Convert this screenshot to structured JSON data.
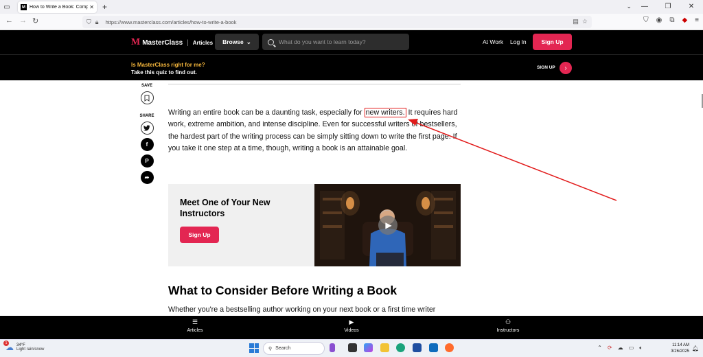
{
  "browser": {
    "tab_title": "How to Write a Book: Complete",
    "tab_favicon": "M",
    "url": "https://www.masterclass.com/articles/how-to-write-a-book"
  },
  "header": {
    "logo_text": "MasterClass",
    "logo_mark": "M",
    "section": "Articles",
    "browse_label": "Browse",
    "search_placeholder": "What do you want to learn today?",
    "at_work": "At Work",
    "log_in": "Log In",
    "sign_up": "Sign Up"
  },
  "quiz": {
    "question": "Is MasterClass right for me?",
    "subtitle": "Take this quiz to find out.",
    "sign_up": "SIGN UP"
  },
  "sidebar": {
    "save_label": "SAVE",
    "share_label": "SHARE"
  },
  "article": {
    "para_before": "Writing an entire book can be a daunting task, especially for ",
    "link_text": "new writers.",
    "para_after": " It requires hard work, extreme ambition, and intense discipline. Even for successful writers of bestsellers, the hardest part of the writing process can be simply sitting down to write the first page. If you take it one step at a time, though, writing a book is an attainable goal.",
    "promo_title": "Meet One of Your New Instructors",
    "promo_button": "Sign Up",
    "heading": "What to Consider Before Writing a Book",
    "para2": "Whether you're a bestselling author working on your next book or a first time writer"
  },
  "bottom_nav": {
    "articles": "Articles",
    "videos": "Videos",
    "instructors": "Instructors"
  },
  "taskbar": {
    "weather_badge": "1",
    "temp": "34°F",
    "weather": "Light rain/snow",
    "search": "Search",
    "time": "11:14 AM",
    "date": "3/26/2025"
  },
  "colors": {
    "brand_red": "#e32652",
    "quiz_yellow": "#f6b73c",
    "annotation_red": "#e21b1b"
  }
}
